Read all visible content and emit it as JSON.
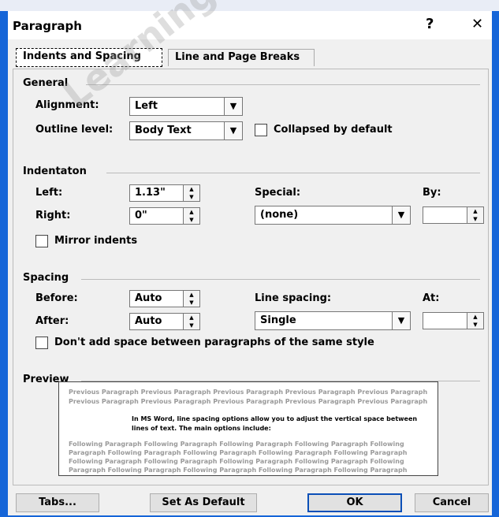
{
  "dialog": {
    "title": "Paragraph",
    "help_label": "?",
    "close_label": "✕"
  },
  "tabs": [
    {
      "label": "Indents and Spacing",
      "active": true
    },
    {
      "label": "Line and Page Breaks",
      "active": false
    }
  ],
  "general": {
    "heading": "General",
    "alignment_label": "Alignment:",
    "alignment_value": "Left",
    "outline_label": "Outline level:",
    "outline_value": "Body Text",
    "collapsed_label": "Collapsed by default",
    "collapsed_checked": false
  },
  "indentation": {
    "heading": "Indentaton",
    "left_label": "Left:",
    "left_value": "1.13\"",
    "right_label": "Right:",
    "right_value": "0\"",
    "special_label": "Special:",
    "special_value": "(none)",
    "by_label": "By:",
    "by_value": "",
    "mirror_label": "Mirror indents",
    "mirror_checked": false
  },
  "spacing": {
    "heading": "Spacing",
    "before_label": "Before:",
    "before_value": "Auto",
    "after_label": "After:",
    "after_value": "Auto",
    "line_spacing_label": "Line spacing:",
    "line_spacing_value": "Single",
    "at_label": "At:",
    "at_value": "",
    "dont_add_label": "Don't add space between paragraphs of the same style",
    "dont_add_checked": false
  },
  "preview": {
    "heading": "Preview",
    "previous_1": "Previous Paragraph Previous Paragraph Previous Paragraph Previous Paragraph Previous Paragraph",
    "previous_2": "Previous Paragraph Previous Paragraph Previous Paragraph Previous Paragraph Previous Paragraph",
    "main_1": "In MS Word, line spacing options allow you to adjust the vertical space between",
    "main_2": "lines of text. The main options include:",
    "following_1": "Following Paragraph Following Paragraph Following Paragraph Following Paragraph Following",
    "following_2": "Paragraph Following Paragraph Following Paragraph Following Paragraph Following Paragraph",
    "following_3": "Following Paragraph Following Paragraph Following Paragraph Following Paragraph Following",
    "following_4": "Paragraph Following Paragraph Following Paragraph Following Paragraph Following Paragraph"
  },
  "buttons": {
    "tabs": "Tabs...",
    "set_default": "Set As Default",
    "ok": "OK",
    "cancel": "Cancel"
  },
  "watermark": "Learning with",
  "colors": {
    "frame_border": "#1565d8",
    "default_button_border": "#0b4fb7"
  }
}
